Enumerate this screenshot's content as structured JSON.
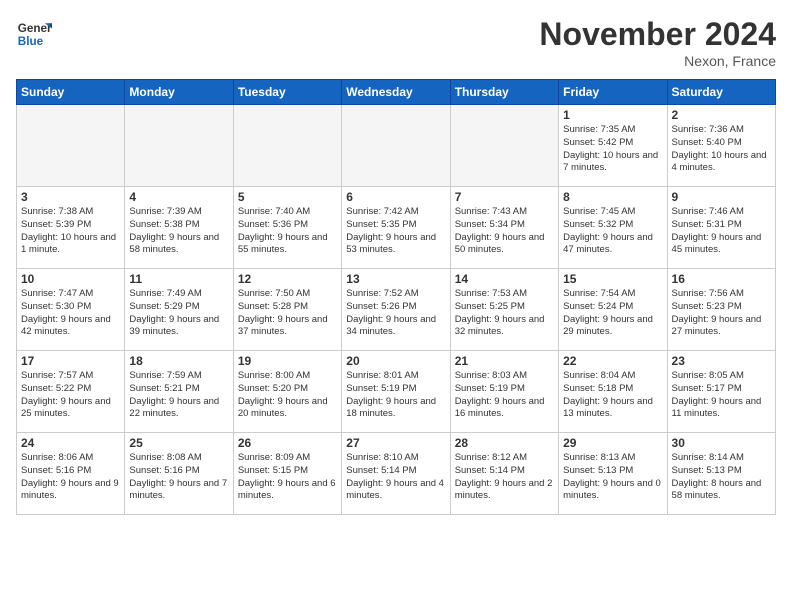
{
  "logo": {
    "line1": "General",
    "line2": "Blue"
  },
  "title": "November 2024",
  "location": "Nexon, France",
  "days_of_week": [
    "Sunday",
    "Monday",
    "Tuesday",
    "Wednesday",
    "Thursday",
    "Friday",
    "Saturday"
  ],
  "weeks": [
    [
      {
        "day": "",
        "content": ""
      },
      {
        "day": "",
        "content": ""
      },
      {
        "day": "",
        "content": ""
      },
      {
        "day": "",
        "content": ""
      },
      {
        "day": "",
        "content": ""
      },
      {
        "day": "1",
        "content": "Sunrise: 7:35 AM\nSunset: 5:42 PM\nDaylight: 10 hours and 7 minutes."
      },
      {
        "day": "2",
        "content": "Sunrise: 7:36 AM\nSunset: 5:40 PM\nDaylight: 10 hours and 4 minutes."
      }
    ],
    [
      {
        "day": "3",
        "content": "Sunrise: 7:38 AM\nSunset: 5:39 PM\nDaylight: 10 hours and 1 minute."
      },
      {
        "day": "4",
        "content": "Sunrise: 7:39 AM\nSunset: 5:38 PM\nDaylight: 9 hours and 58 minutes."
      },
      {
        "day": "5",
        "content": "Sunrise: 7:40 AM\nSunset: 5:36 PM\nDaylight: 9 hours and 55 minutes."
      },
      {
        "day": "6",
        "content": "Sunrise: 7:42 AM\nSunset: 5:35 PM\nDaylight: 9 hours and 53 minutes."
      },
      {
        "day": "7",
        "content": "Sunrise: 7:43 AM\nSunset: 5:34 PM\nDaylight: 9 hours and 50 minutes."
      },
      {
        "day": "8",
        "content": "Sunrise: 7:45 AM\nSunset: 5:32 PM\nDaylight: 9 hours and 47 minutes."
      },
      {
        "day": "9",
        "content": "Sunrise: 7:46 AM\nSunset: 5:31 PM\nDaylight: 9 hours and 45 minutes."
      }
    ],
    [
      {
        "day": "10",
        "content": "Sunrise: 7:47 AM\nSunset: 5:30 PM\nDaylight: 9 hours and 42 minutes."
      },
      {
        "day": "11",
        "content": "Sunrise: 7:49 AM\nSunset: 5:29 PM\nDaylight: 9 hours and 39 minutes."
      },
      {
        "day": "12",
        "content": "Sunrise: 7:50 AM\nSunset: 5:28 PM\nDaylight: 9 hours and 37 minutes."
      },
      {
        "day": "13",
        "content": "Sunrise: 7:52 AM\nSunset: 5:26 PM\nDaylight: 9 hours and 34 minutes."
      },
      {
        "day": "14",
        "content": "Sunrise: 7:53 AM\nSunset: 5:25 PM\nDaylight: 9 hours and 32 minutes."
      },
      {
        "day": "15",
        "content": "Sunrise: 7:54 AM\nSunset: 5:24 PM\nDaylight: 9 hours and 29 minutes."
      },
      {
        "day": "16",
        "content": "Sunrise: 7:56 AM\nSunset: 5:23 PM\nDaylight: 9 hours and 27 minutes."
      }
    ],
    [
      {
        "day": "17",
        "content": "Sunrise: 7:57 AM\nSunset: 5:22 PM\nDaylight: 9 hours and 25 minutes."
      },
      {
        "day": "18",
        "content": "Sunrise: 7:59 AM\nSunset: 5:21 PM\nDaylight: 9 hours and 22 minutes."
      },
      {
        "day": "19",
        "content": "Sunrise: 8:00 AM\nSunset: 5:20 PM\nDaylight: 9 hours and 20 minutes."
      },
      {
        "day": "20",
        "content": "Sunrise: 8:01 AM\nSunset: 5:19 PM\nDaylight: 9 hours and 18 minutes."
      },
      {
        "day": "21",
        "content": "Sunrise: 8:03 AM\nSunset: 5:19 PM\nDaylight: 9 hours and 16 minutes."
      },
      {
        "day": "22",
        "content": "Sunrise: 8:04 AM\nSunset: 5:18 PM\nDaylight: 9 hours and 13 minutes."
      },
      {
        "day": "23",
        "content": "Sunrise: 8:05 AM\nSunset: 5:17 PM\nDaylight: 9 hours and 11 minutes."
      }
    ],
    [
      {
        "day": "24",
        "content": "Sunrise: 8:06 AM\nSunset: 5:16 PM\nDaylight: 9 hours and 9 minutes."
      },
      {
        "day": "25",
        "content": "Sunrise: 8:08 AM\nSunset: 5:16 PM\nDaylight: 9 hours and 7 minutes."
      },
      {
        "day": "26",
        "content": "Sunrise: 8:09 AM\nSunset: 5:15 PM\nDaylight: 9 hours and 6 minutes."
      },
      {
        "day": "27",
        "content": "Sunrise: 8:10 AM\nSunset: 5:14 PM\nDaylight: 9 hours and 4 minutes."
      },
      {
        "day": "28",
        "content": "Sunrise: 8:12 AM\nSunset: 5:14 PM\nDaylight: 9 hours and 2 minutes."
      },
      {
        "day": "29",
        "content": "Sunrise: 8:13 AM\nSunset: 5:13 PM\nDaylight: 9 hours and 0 minutes."
      },
      {
        "day": "30",
        "content": "Sunrise: 8:14 AM\nSunset: 5:13 PM\nDaylight: 8 hours and 58 minutes."
      }
    ]
  ]
}
